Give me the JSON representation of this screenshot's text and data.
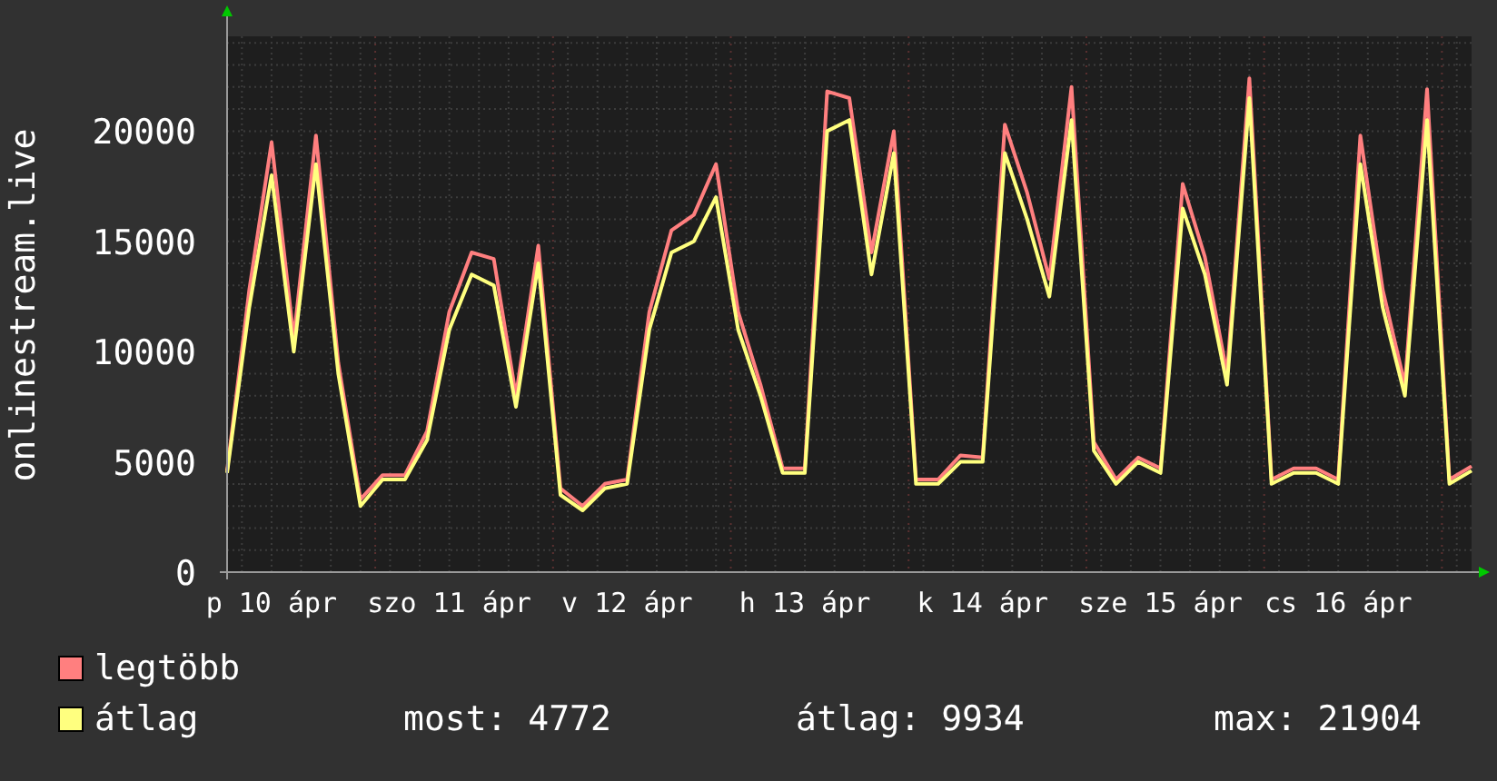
{
  "chart": {
    "chart_data": {
      "type": "line",
      "ylabel": "onlinestream.live",
      "categories": [
        null,
        null,
        "p 10 ápr",
        null,
        null,
        null,
        null,
        null,
        null,
        null,
        "szo 11 ápr",
        null,
        null,
        null,
        null,
        null,
        null,
        null,
        "v 12 ápr",
        null,
        null,
        null,
        null,
        null,
        null,
        null,
        "h 13 ápr",
        null,
        null,
        null,
        null,
        null,
        null,
        null,
        "k 14 ápr",
        null,
        null,
        null,
        null,
        null,
        null,
        null,
        "sze 15 ápr",
        null,
        null,
        null,
        null,
        null,
        null,
        null,
        "cs 16 ápr",
        null,
        null,
        null,
        null,
        null,
        null
      ],
      "series": [
        {
          "name": "legtöbb",
          "color": "#ff7f7f",
          "values": [
            4600,
            12800,
            19500,
            10600,
            19800,
            9500,
            3300,
            4400,
            4400,
            6400,
            11800,
            14500,
            14200,
            8000,
            14800,
            3800,
            3000,
            4000,
            4200,
            11800,
            15500,
            16200,
            18500,
            11800,
            8500,
            4700,
            4700,
            21800,
            21500,
            14500,
            20000,
            4200,
            4200,
            5300,
            5200,
            20300,
            17200,
            13300,
            22000,
            5900,
            4200,
            5200,
            4700,
            17600,
            14300,
            9000,
            22400,
            4200,
            4700,
            4700,
            4200,
            19800,
            12800,
            8500,
            21900,
            4200,
            4800
          ]
        },
        {
          "name": "átlag",
          "color": "#ffff7f",
          "values": [
            4500,
            12000,
            18000,
            10000,
            18500,
            9000,
            3000,
            4200,
            4200,
            6000,
            11000,
            13500,
            13000,
            7500,
            14000,
            3500,
            2800,
            3800,
            4000,
            11000,
            14500,
            15000,
            17000,
            11000,
            8000,
            4500,
            4500,
            20000,
            20500,
            13500,
            19000,
            4000,
            4000,
            5000,
            5000,
            19000,
            16000,
            12500,
            20500,
            5500,
            4000,
            5000,
            4500,
            16500,
            13500,
            8500,
            21500,
            4000,
            4500,
            4500,
            4000,
            18500,
            12000,
            8000,
            20500,
            4000,
            4600
          ]
        }
      ],
      "ylim": [
        0,
        24300
      ],
      "grid": true,
      "yticks": [
        0,
        5000,
        10000,
        15000,
        20000
      ]
    }
  },
  "stats": [
    "most: 4772",
    "átlag: 9934",
    "max: 21904"
  ]
}
